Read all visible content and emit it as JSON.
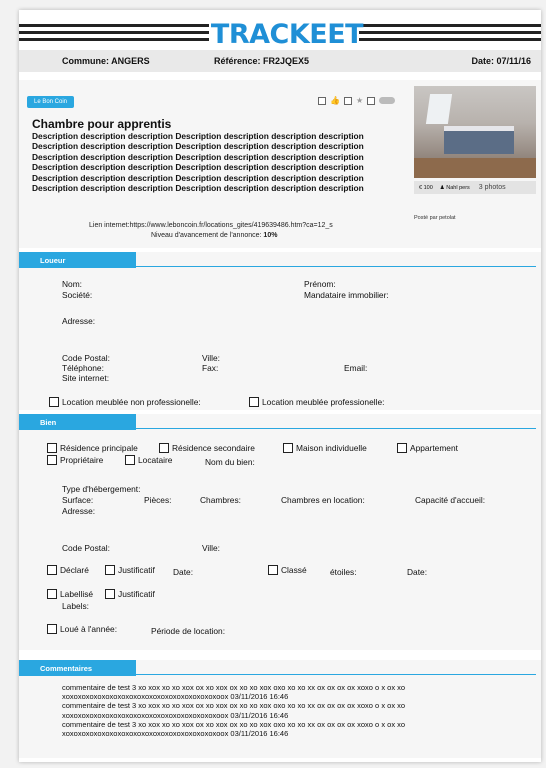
{
  "header": {
    "logo_text": "TRACKEET",
    "commune": "Commune: ANGERS",
    "reference": "Référence: FR2JQEX5",
    "date": "Date: 07/11/16"
  },
  "annonce": {
    "source": "Le Bon Coin",
    "title": "Chambre pour apprentis",
    "description_lines": [
      "Description description description Description description description description",
      "Description description description Description description description description",
      "Description description description Description description description description",
      "Description description description Description description description description",
      "Description description description Description description description description",
      "Description description description Description description description description"
    ],
    "price": "€ 100",
    "owner": "Nahl pers",
    "photos": "3 photos",
    "posted_by": "Posté par petolat",
    "link": "Lien internet:https://www.leboncoin.fr/locations_gites/419639486.htm?ca=12_s",
    "level_label": "Niveau d'avancement de l'annonce:",
    "level_value": "10%"
  },
  "loueur": {
    "title": "Loueur",
    "nom": "Nom:",
    "prenom": "Prénom:",
    "societe": "Société:",
    "mandataire": "Mandataire immobilier:",
    "adresse": "Adresse:",
    "code_postal": "Code Postal:",
    "ville": "Ville:",
    "telephone": "Téléphone:",
    "fax": "Fax:",
    "email": "Email:",
    "site": "Site internet:",
    "loc_non_pro": "Location meublée non professionelle:",
    "loc_pro": "Location meublée professionelle:"
  },
  "bien": {
    "title": "Bien",
    "residence_principale": "Résidence principale",
    "residence_secondaire": "Résidence secondaire",
    "maison": "Maison individuelle",
    "appartement": "Appartement",
    "proprietaire": "Propriétaire",
    "locataire": "Locataire",
    "nom_bien": "Nom du bien:",
    "type": "Type d'hébergement:",
    "surface": "Surface:",
    "pieces": "Pièces:",
    "chambres": "Chambres:",
    "chambres_loc": "Chambres en location:",
    "capacite": "Capacité d'accueil:",
    "adresse": "Adresse:",
    "code_postal": "Code Postal:",
    "ville": "Ville:",
    "declare": "Déclaré",
    "justificatif": "Justificatif",
    "date": "Date:",
    "classe": "Classé",
    "etoiles": "étoiles:",
    "date2": "Date:",
    "labellise": "Labellisé",
    "justificatif2": "Justificatif",
    "labels": "Labels:",
    "loue_annee": "Loué à l'année:",
    "periode": "Période de location:"
  },
  "commentaires": {
    "title": "Commentaires",
    "lines": [
      "commentaire de test 3 xo xox xo xo xox ox xo xox ox xo xo xox oxo xo xo xx ox ox ox ox xoxo o x ox xo",
      "xoxoxoxoxoxoxoxoxoxoxoxoxoxoxoxoxoxoxoxoox   03/11/2016 16:46",
      "commentaire de test 3 xo xox xo xo xox ox xo xox ox xo xo xox oxo xo xo xx ox ox ox ox xoxo o x ox xo",
      "xoxoxoxoxoxoxoxoxoxoxoxoxoxoxoxoxoxoxoxoox   03/11/2016 16:46",
      "commentaire de test 3 xo xox xo xo xox ox xo xox ox xo xo xox oxo xo xo xx ox ox ox ox xoxo o x ox xo",
      "xoxoxoxoxoxoxoxoxoxoxoxoxoxoxoxoxoxoxoxoox   03/11/2016 16:46"
    ]
  },
  "colors": {
    "accent": "#2aa7e0",
    "logo": "#1f8fd6"
  }
}
